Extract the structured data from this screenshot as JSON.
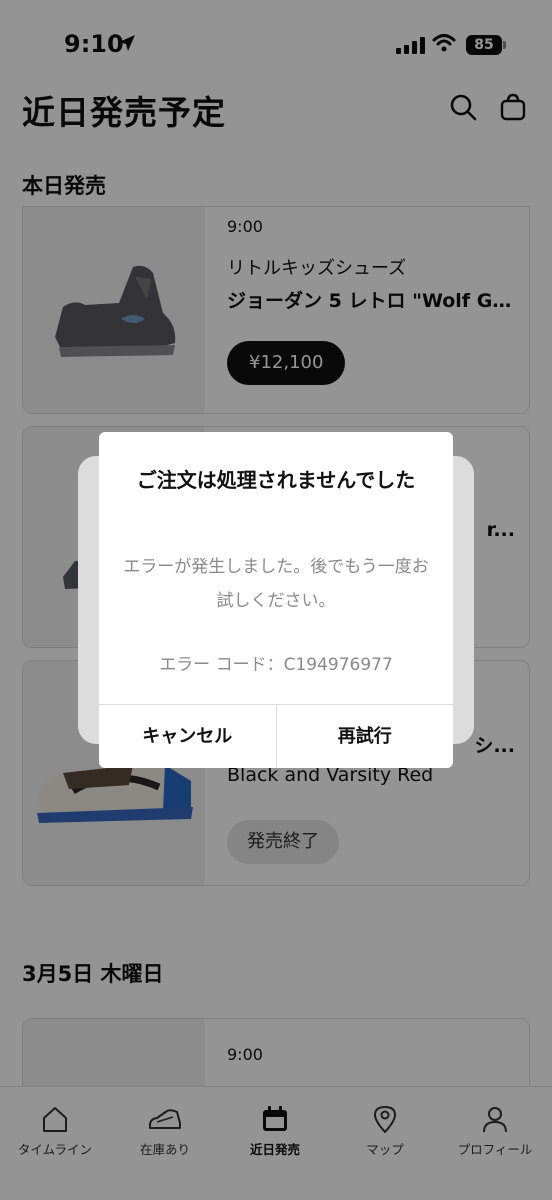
{
  "status": {
    "time": "9:10",
    "battery": "85"
  },
  "header": {
    "title": "近日発売予定"
  },
  "sections": {
    "today": "本日発売",
    "upcoming": "3月5日 木曜日"
  },
  "cards": [
    {
      "time": "9:00",
      "category": "リトルキッズシューズ",
      "name": "ジョーダン 5 レトロ \"Wolf Gr...",
      "price": "¥12,100"
    },
    {
      "name_fragment": "r..."
    },
    {
      "fragment": "シ...",
      "name": "Black and Varsity Red",
      "status": "発売終了"
    },
    {
      "time": "9:00"
    }
  ],
  "dialog": {
    "title": "ご注文は処理されませんでした",
    "message": "エラーが発生しました。後でもう一度お試しください。",
    "code": "エラー コード：C194976977",
    "cancel": "キャンセル",
    "retry": "再試行"
  },
  "tabs": [
    {
      "label": "タイムライン",
      "icon": "home-icon"
    },
    {
      "label": "在庫あり",
      "icon": "shoe-icon"
    },
    {
      "label": "近日発売",
      "icon": "calendar-icon",
      "active": true
    },
    {
      "label": "マップ",
      "icon": "map-pin-icon"
    },
    {
      "label": "プロフィール",
      "icon": "person-icon"
    }
  ]
}
